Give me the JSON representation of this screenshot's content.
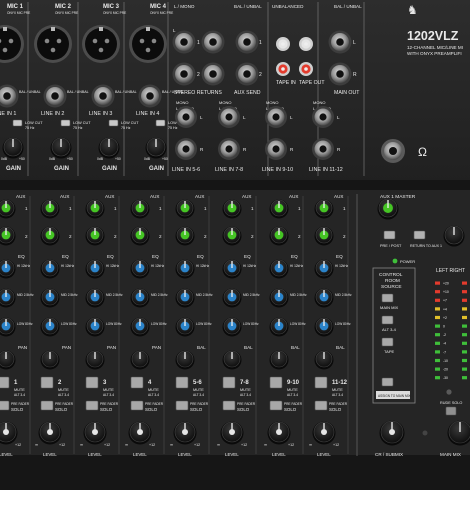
{
  "brand": {
    "model": "1202VLZ",
    "subtitle_lines": [
      "12-CHANNEL MIC/LINE MI",
      "WITH ONYX PREAMPLIFI"
    ]
  },
  "top_section": {
    "mic_labels": [
      "MIC 1",
      "MIC 2",
      "MIC 3",
      "MIC 4"
    ],
    "mic_sublabels": [
      "ONYX MIC PRE",
      "ONYX MIC PRE",
      "ONYX MIC PRE",
      "ONYX MIC PRE"
    ],
    "line_in_labels": [
      "LINE IN 1",
      "LINE IN 2",
      "LINE IN 3",
      "LINE IN 4"
    ],
    "bal_unbal": "BAL / UNBAL",
    "low_cut": "LOW CUT",
    "low_cut_freq": "75 Hz",
    "gain": "GAIN",
    "gain_scale_left": "0dB",
    "gain_scale_right": "+50",
    "stereo_returns": "STEREO RETURNS",
    "aux_send": "AUX SEND",
    "l_mono": "L / MONO",
    "bal_unbal_top": "BAL / UNBAL",
    "unbalanced": "UNBALANCED",
    "tape_in": "TAPE IN",
    "tape_out": "TAPE OUT",
    "main_out": "MAIN OUT",
    "mono": "MONO",
    "stereo_line_inputs": [
      "LINE IN 5-6",
      "LINE IN 7-8",
      "LINE IN 9-10",
      "LINE IN 11-12"
    ],
    "lr": [
      "L",
      "R"
    ],
    "return_nums": [
      "1",
      "2"
    ],
    "aux_nums": [
      "1",
      "2"
    ],
    "phones_symbol": "Ω"
  },
  "channel_strip": {
    "aux_label": "AUX",
    "aux_nums": [
      "1",
      "2"
    ],
    "eq_label": "EQ",
    "eq_bands": [
      "HI 12kHz",
      "MID 2.5kHz",
      "LOW 80Hz"
    ],
    "pan_label": "PAN",
    "bal_label": "BAL",
    "channel_numbers": [
      "1",
      "2",
      "3",
      "4",
      "5-6",
      "7-8",
      "9-10",
      "11-12"
    ],
    "mute_label": "MUTE",
    "mute_sub": "ALT 3-4",
    "pre_fader": "PRE FADER",
    "solo": "SOLO",
    "level": "LEVEL",
    "level_scale_left": "∞",
    "level_scale_right": "+12"
  },
  "master": {
    "aux1_master": "AUX 1 MASTER",
    "pre_post": "PRE / POST",
    "return_to_aux1": "RETURN TO AUX 1",
    "power": "POWER",
    "control_room_source": [
      "CONTROL",
      "ROOM",
      "SOURCE"
    ],
    "main_mix": "MAIN MIX",
    "alt_34": "ALT 3-4",
    "tape": "TAPE",
    "assign_to_main_mix": "ASSIGN TO MAIN MIX",
    "rude_solo": "RUDE SOLO",
    "cr_submix": "CR / SUBMIX",
    "main_mix_level": "MAIN MIX",
    "meter_left_right": "LEFT  RIGHT",
    "meter_marks": [
      "+20",
      "+10",
      "+7",
      "+4",
      "+2",
      "0",
      "-2",
      "-4",
      "-7",
      "-10",
      "-20",
      "-30"
    ]
  },
  "colors": {
    "panel": "#262626",
    "panel_dark": "#171717",
    "knob_green": "#45c424",
    "knob_blue": "#2b83c9",
    "led_red": "#e33b2d",
    "led_yellow": "#e1c02a",
    "led_green": "#3fbf3a"
  }
}
